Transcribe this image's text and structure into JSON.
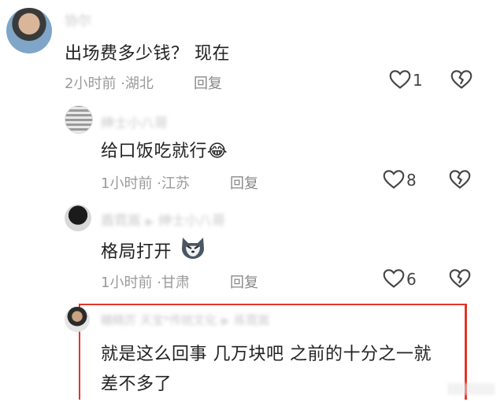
{
  "comments": [
    {
      "username": "协尔",
      "text": "出场费多少钱？ 现在",
      "time": "2小时前",
      "location": "湖北",
      "reply_label": "回复",
      "likes": "1"
    },
    {
      "username": "绅士小八哥",
      "text": "给口饭吃就行",
      "emoji": "😂",
      "time": "1小时前",
      "location": "江苏",
      "reply_label": "回复",
      "likes": "8"
    },
    {
      "username": "盾霓嵩",
      "reply_to": "绅士小八哥",
      "text": "格局打开",
      "time": "1小时前",
      "location": "甘肃",
      "reply_label": "回复",
      "likes": "6"
    },
    {
      "username": "糖精厉 天宝*传统文化",
      "reply_to": "练霓嵩",
      "text_line1": "就是这么回事 几万块吧 之前的十分之一就",
      "text_line2": "差不多了"
    }
  ],
  "separator": "·",
  "icons": {
    "like": "heart-outline-icon",
    "dislike": "broken-heart-icon",
    "reply_arrow": "triangle-right-icon"
  },
  "colors": {
    "highlight_border": "#e0352b",
    "meta_text": "#9a9a9a"
  }
}
